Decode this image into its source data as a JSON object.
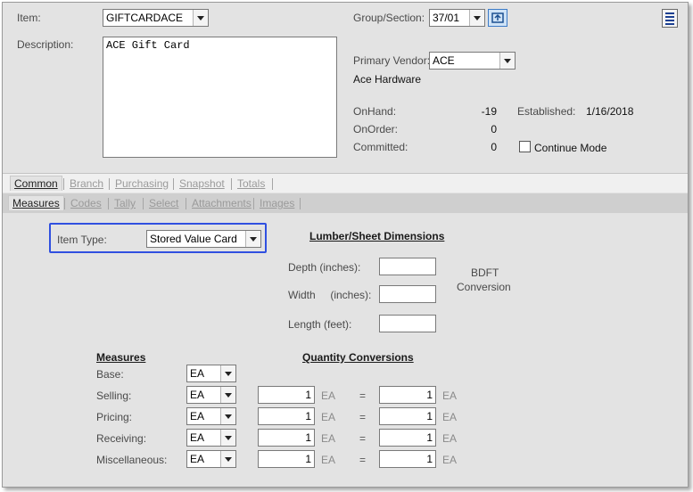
{
  "item": {
    "label": "Item:",
    "value": "GIFTCARDACE"
  },
  "description": {
    "label": "Description:",
    "value": "ACE Gift Card"
  },
  "group": {
    "label": "Group/Section:",
    "value": "37/01"
  },
  "vendor": {
    "label": "Primary Vendor:",
    "value": "ACE",
    "name": "Ace Hardware"
  },
  "stock": {
    "onhand_label": "OnHand:",
    "onhand": "-19",
    "onorder_label": "OnOrder:",
    "onorder": "0",
    "committed_label": "Committed:",
    "committed": "0",
    "established_label": "Established:",
    "established": "1/16/2018",
    "continue_mode_label": "Continue Mode"
  },
  "tabs_primary": [
    "Common",
    "Branch",
    "Purchasing",
    "Snapshot",
    "Totals"
  ],
  "tabs_secondary": [
    "Measures",
    "Codes",
    "Tally",
    "Select",
    "Attachments",
    "Images"
  ],
  "item_type": {
    "label": "Item Type:",
    "value": "Stored Value Card"
  },
  "lumber": {
    "heading": "Lumber/Sheet Dimensions",
    "depth_label": "Depth (inches):",
    "width_label": "Width     (inches):",
    "length_label": "Length (feet):",
    "bdft_line1": "BDFT",
    "bdft_line2": "Conversion"
  },
  "measures": {
    "heading": "Measures",
    "qc_heading": "Quantity Conversions",
    "rows": [
      {
        "label": "Base:",
        "unit": "EA"
      },
      {
        "label": "Selling:",
        "unit": "EA",
        "qty1": "1",
        "u1": "EA",
        "eq": "=",
        "qty2": "1",
        "u2": "EA"
      },
      {
        "label": "Pricing:",
        "unit": "EA",
        "qty1": "1",
        "u1": "EA",
        "eq": "=",
        "qty2": "1",
        "u2": "EA"
      },
      {
        "label": "Receiving:",
        "unit": "EA",
        "qty1": "1",
        "u1": "EA",
        "eq": "=",
        "qty2": "1",
        "u2": "EA"
      },
      {
        "label": "Miscellaneous:",
        "unit": "EA",
        "qty1": "1",
        "u1": "EA",
        "eq": "=",
        "qty2": "1",
        "u2": "EA"
      }
    ]
  },
  "colors": {
    "highlight": "#3050e0",
    "background": "#e3e3e3",
    "secondary_bar": "#cfcfcf"
  }
}
